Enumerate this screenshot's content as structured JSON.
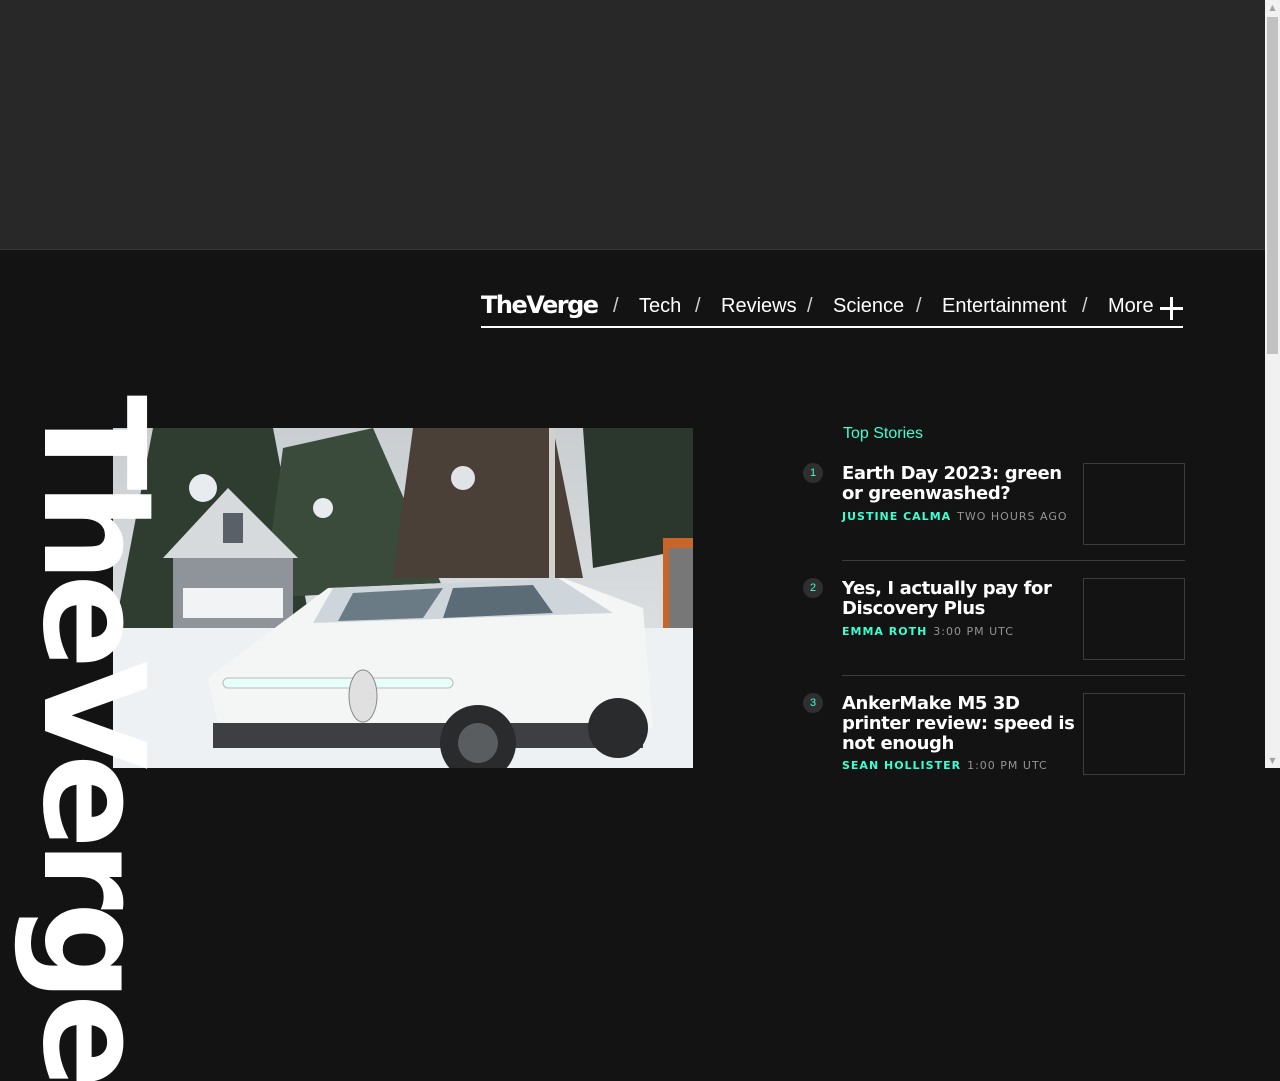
{
  "nav": {
    "logo": "TheVerge",
    "separator": "/",
    "items": [
      "Tech",
      "Reviews",
      "Science",
      "Entertainment",
      "More"
    ],
    "more_icon": "plus-icon"
  },
  "hero": {
    "image_description_icon": "hero-photo",
    "vertical_logo": "TheVerge"
  },
  "top_stories": {
    "heading": "Top Stories",
    "stories": [
      {
        "rank": "1",
        "title": "Earth Day 2023: green or greenwashed?",
        "author": "JUSTINE CALMA",
        "time": "TWO HOURS AGO"
      },
      {
        "rank": "2",
        "title": "Yes, I actually pay for Discovery Plus",
        "author": "EMMA ROTH",
        "time": "3:00 PM UTC"
      },
      {
        "rank": "3",
        "title": "AnkerMake M5 3D printer review: speed is not enough",
        "author": "SEAN HOLLISTER",
        "time": "1:00 PM UTC"
      }
    ]
  },
  "colors": {
    "accent": "#3cffd0",
    "background": "#131313",
    "ad_band": "#282828"
  }
}
